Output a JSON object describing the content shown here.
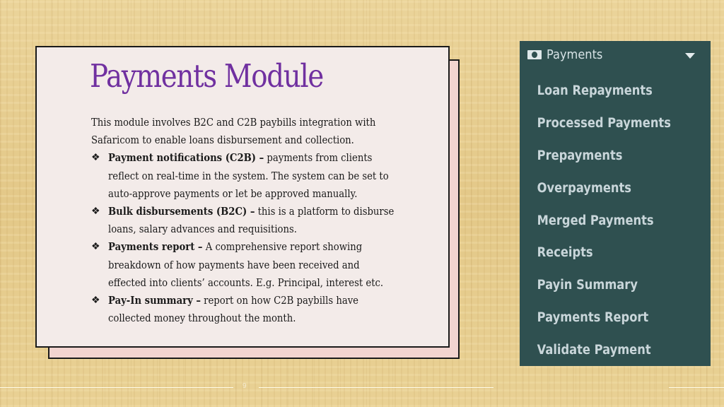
{
  "slide": {
    "title": "Payments Module",
    "intro": [
      "This module involves B2C and C2B paybills integration with",
      "Safaricom to enable loans disbursement and collection."
    ],
    "bullet_icon": "diamond-bullet-icon",
    "bullets": [
      {
        "bold": "Payment notifications (C2B) –",
        "lines": [
          " payments from clients",
          "reflect on real-time in the system. The system can be set to",
          "auto-approve payments or let be approved manually."
        ]
      },
      {
        "bold": "Bulk disbursements (B2C) –",
        "lines": [
          " this is a platform to disburse",
          "loans, salary advances and requisitions."
        ]
      },
      {
        "bold": "Payments report –",
        "lines": [
          " A comprehensive report showing",
          "breakdown of how payments have been received and",
          "effected into clients’ accounts. E.g. Principal, interest etc."
        ]
      },
      {
        "bold": "Pay-In summary –",
        "lines": [
          " report on how C2B paybills have",
          "collected money throughout the month."
        ]
      }
    ],
    "page_number": "9"
  },
  "menu_panel": {
    "header": {
      "icon": "money-icon",
      "label": "Payments",
      "caret": "caret-down-icon"
    },
    "items": [
      "Loan Repayments",
      "Processed Payments",
      "Prepayments",
      "Overpayments",
      "Merged Payments",
      "Receipts",
      "Payin Summary",
      "Payments Report",
      "Validate Payment"
    ],
    "colors": {
      "background": "#2f5050",
      "text": "#c9d6da"
    }
  },
  "colors": {
    "title": "#7030a0",
    "card": "#f3ebe9",
    "card_shadow": "#f2d4d0"
  }
}
